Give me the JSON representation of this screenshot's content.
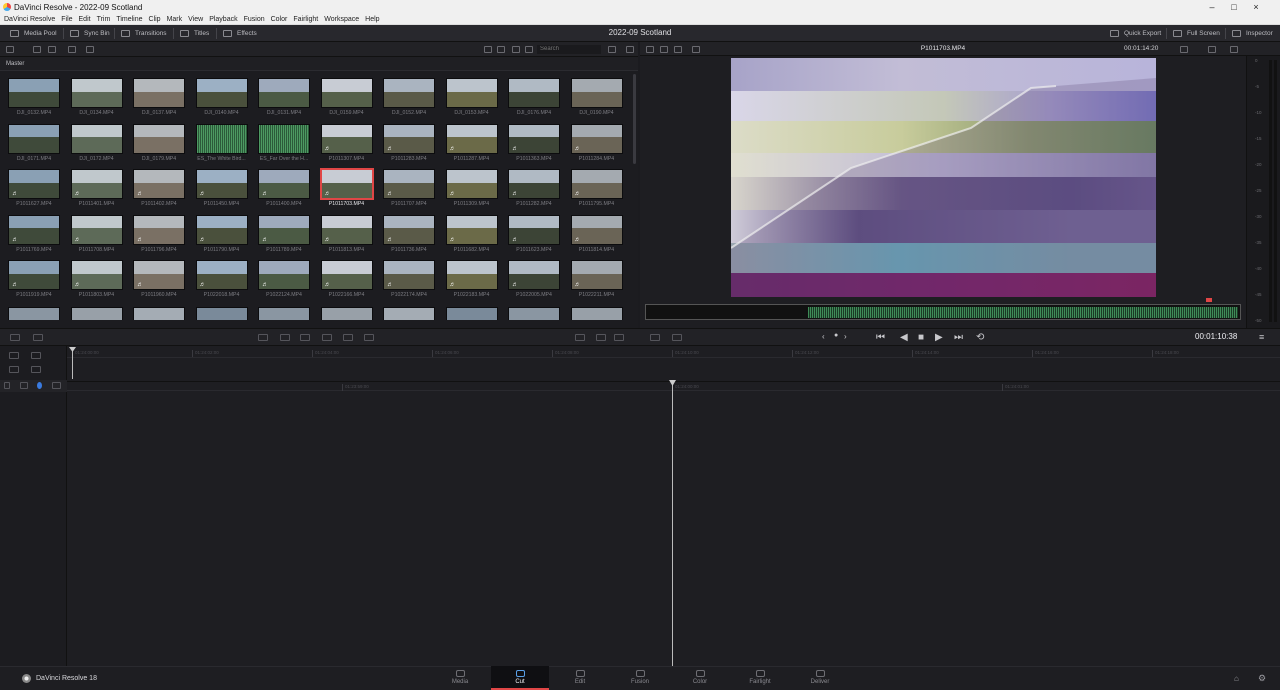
{
  "window": {
    "title": "DaVinci Resolve - 2022-09 Scotland"
  },
  "menu": [
    "DaVinci Resolve",
    "File",
    "Edit",
    "Trim",
    "Timeline",
    "Clip",
    "Mark",
    "View",
    "Playback",
    "Fusion",
    "Color",
    "Fairlight",
    "Workspace",
    "Help"
  ],
  "toolbar": {
    "media_pool": "Media Pool",
    "sync_bin": "Sync Bin",
    "transitions": "Transitions",
    "titles": "Titles",
    "effects": "Effects",
    "project_title": "2022-09 Scotland",
    "quick_export": "Quick Export",
    "full_screen": "Full Screen",
    "inspector": "Inspector"
  },
  "media_pool": {
    "search_placeholder": "Search",
    "bin": "Master",
    "clips": [
      "DJI_0132.MP4",
      "DJI_0134.MP4",
      "DJI_0137.MP4",
      "DJI_0140.MP4",
      "DJI_0131.MP4",
      "DJI_0159.MP4",
      "DJI_0152.MP4",
      "DJI_0153.MP4",
      "DJI_0176.MP4",
      "DJI_0190.MP4",
      "DJI_0171.MP4",
      "DJI_0172.MP4",
      "DJI_0179.MP4",
      "ES_The White Bird...",
      "ES_Far Over the H...",
      "P1011307.MP4",
      "P1011283.MP4",
      "P1011287.MP4",
      "P1011363.MP4",
      "P1011284.MP4",
      "P1011627.MP4",
      "P1011401.MP4",
      "P1011402.MP4",
      "P1011450.MP4",
      "P1011400.MP4",
      "P1011703.MP4",
      "P1011707.MP4",
      "P1011309.MP4",
      "P1011282.MP4",
      "P1011795.MP4",
      "P1011769.MP4",
      "P1011708.MP4",
      "P1011796.MP4",
      "P1011790.MP4",
      "P1011789.MP4",
      "P1011813.MP4",
      "P1011736.MP4",
      "P1011682.MP4",
      "P1011623.MP4",
      "P1011814.MP4",
      "P1011919.MP4",
      "P1011803.MP4",
      "P1011960.MP4",
      "P1022018.MP4",
      "P1022124.MP4",
      "P1022166.MP4",
      "P1022174.MP4",
      "P1022183.MP4",
      "P1022005.MP4",
      "P1022211.MP4"
    ],
    "selected": "P1011703.MP4"
  },
  "viewer": {
    "clip_name": "P1011703.MP4",
    "source_timecode": "00:01:14:20",
    "record_timecode": "00:01:10:38",
    "meter_labels": [
      "0",
      "-5",
      "-10",
      "-15",
      "-20",
      "-25",
      "-30",
      "-35",
      "-40",
      "-45",
      "-50"
    ]
  },
  "timeline": {
    "upper_ruler": [
      "01:24:00:00",
      "01:24:02:00",
      "01:24:04:00",
      "01:24:06:00",
      "01:24:08:00",
      "01:24:10:00",
      "01:24:12:00",
      "01:24:14:00",
      "01:24:16:00",
      "01:24:18:00"
    ],
    "lower_ruler": [
      "01:23:59:00",
      "01:24:00:00",
      "01:24:01:00"
    ]
  },
  "pages": [
    {
      "label": "Media",
      "active": false
    },
    {
      "label": "Cut",
      "active": true
    },
    {
      "label": "Edit",
      "active": false
    },
    {
      "label": "Fusion",
      "active": false
    },
    {
      "label": "Color",
      "active": false
    },
    {
      "label": "Fairlight",
      "active": false
    },
    {
      "label": "Deliver",
      "active": false
    }
  ],
  "brand": "DaVinci Resolve 18",
  "colors": {
    "accent": "#e04646",
    "panel": "#1e1e22",
    "selected_border": "#e04646"
  }
}
